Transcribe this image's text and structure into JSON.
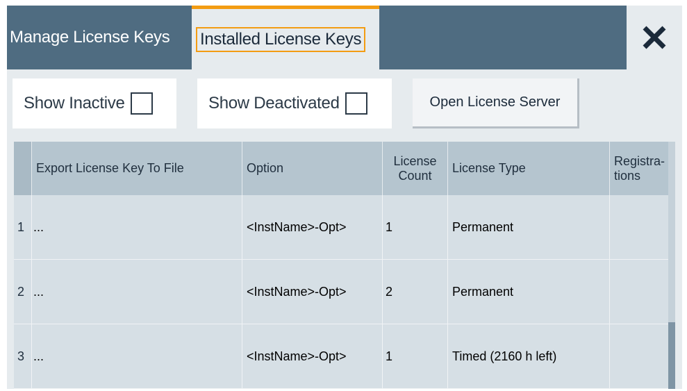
{
  "tabs": {
    "manage_label": "Manage License Keys",
    "installed_label": "Installed License Keys"
  },
  "toolbar": {
    "show_inactive_label": "Show Inactive",
    "show_deactivated_label": "Show Deactivated",
    "open_server_label": "Open License Server"
  },
  "table": {
    "headers": {
      "export": "Export License Key To File",
      "option": "Option",
      "count": "License Count",
      "type": "License Type",
      "registrations": "Registra-tions"
    },
    "rows": [
      {
        "index": "1",
        "export": "...",
        "option": "<InstName>-Opt>",
        "count": "1",
        "type": "Permanent",
        "registrations": ""
      },
      {
        "index": "2",
        "export": "...",
        "option": "<InstName>-Opt>",
        "count": "2",
        "type": "Permanent",
        "registrations": ""
      },
      {
        "index": "3",
        "export": "...",
        "option": "<InstName>-Opt>",
        "count": "1",
        "type": "Timed (2160 h left)",
        "registrations": ""
      }
    ]
  },
  "icons": {
    "close": "close-icon",
    "checkbox": "checkbox-icon"
  },
  "colors": {
    "accent": "#f39c12",
    "header_bg": "#4f6c81",
    "table_header": "#b5c5cf"
  }
}
